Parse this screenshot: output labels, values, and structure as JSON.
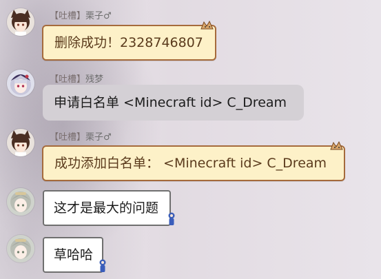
{
  "messages": [
    {
      "sender_tag": "【吐槽】",
      "sender_name": "栗子♂",
      "text": "删除成功！2328746807",
      "avatar": "avatar-cat-girl"
    },
    {
      "sender_tag": "【吐槽】",
      "sender_name": "残梦",
      "text": "申请白名单  <Minecraft id> C_Dream",
      "avatar": "avatar-silver-hair-girl"
    },
    {
      "sender_tag": "【吐槽】",
      "sender_name": "栗子♂",
      "text": "成功添加白名单：  <Minecraft id> C_Dream",
      "avatar": "avatar-cat-girl"
    },
    {
      "text": "这才是最大的问题",
      "avatar": "avatar-gray-hair-girl"
    },
    {
      "text": "草哈哈",
      "avatar": "avatar-gray-hair-girl"
    }
  ],
  "colors": {
    "yellow_bubble_bg": "#fdf1c8",
    "yellow_bubble_border": "#a56a3b",
    "gray_bubble_bg": "#d4d0d5",
    "white_bubble_border": "#6f6f6f"
  }
}
